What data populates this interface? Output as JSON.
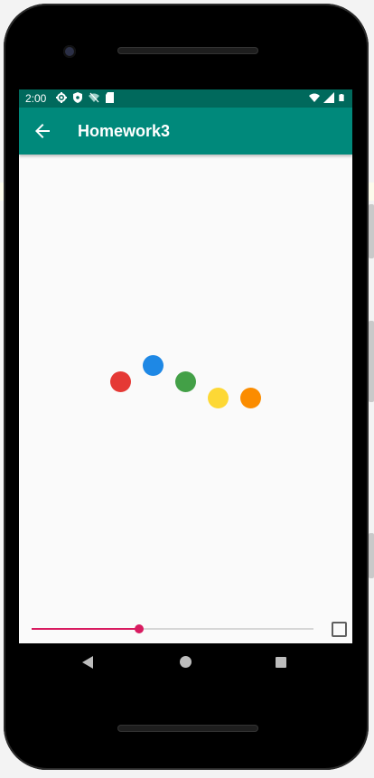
{
  "status_bar": {
    "time": "2:00",
    "background": "#00695c",
    "left_icons": [
      "gear-icon",
      "shield-icon",
      "wifi-slash-icon",
      "sd-card-icon"
    ],
    "right_icons": [
      "wifi-icon",
      "cell-signal-icon",
      "battery-icon"
    ]
  },
  "app_bar": {
    "title": "Homework3",
    "background": "#00897b",
    "back_icon": "arrow-left-icon"
  },
  "dots": [
    {
      "color": "#e53935"
    },
    {
      "color": "#1e88e5"
    },
    {
      "color": "#43a047"
    },
    {
      "color": "#fdd835"
    },
    {
      "color": "#fb8c00"
    }
  ],
  "seekbar": {
    "progress": 0.38,
    "accent": "#d81b60"
  },
  "checkbox": {
    "checked": false
  },
  "nav_bar": {
    "icons": [
      "back-triangle-icon",
      "home-circle-icon",
      "recents-square-icon"
    ]
  }
}
